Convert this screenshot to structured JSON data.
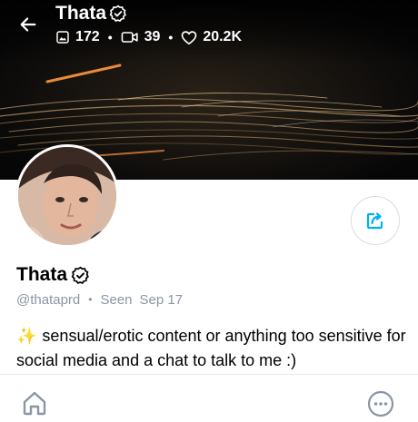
{
  "header": {
    "name": "Thata",
    "stats": {
      "photos": "172",
      "videos": "39",
      "likes": "20.2K"
    },
    "separator": "•"
  },
  "profile": {
    "name": "Thata",
    "handle": "@thataprd",
    "separator": "•",
    "seen_label": "Seen",
    "seen_date": "Sep 17",
    "bio_emoji": "✨",
    "bio_text": "sensual/erotic content or anything too sensitive for social media and a chat to talk to me :)"
  },
  "icons": {
    "back": "arrow-left-icon",
    "verified": "verified-badge-icon",
    "photos": "image-icon",
    "videos": "video-icon",
    "likes": "heart-icon",
    "share": "share-icon",
    "home": "home-icon",
    "more": "more-options-icon"
  },
  "colors": {
    "accent": "#00aff0",
    "muted": "#8a96a3",
    "cover_bg": "#0b0b0c"
  }
}
